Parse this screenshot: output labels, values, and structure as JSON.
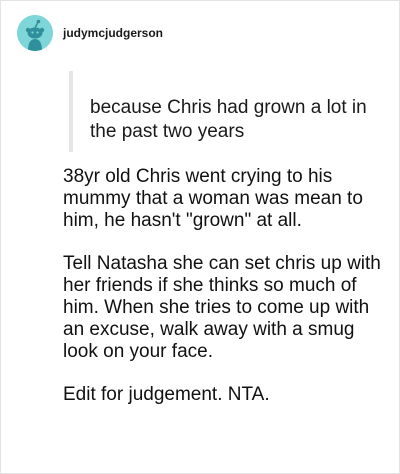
{
  "post": {
    "username": "judymcjudgerson",
    "avatar_icon": "reddit-snoo-icon",
    "avatar_color": "#7fd6d8",
    "quote": "because Chris had grown a lot in the past two years",
    "paragraphs": [
      "38yr old Chris went crying to his mummy that a woman was mean to him, he hasn't \"grown\" at all.",
      "Tell Natasha she can set chris up with her friends if she thinks so much of him. When she tries to come up with an excuse, walk away with a smug look on your face.",
      "Edit for judgement. NTA."
    ]
  }
}
